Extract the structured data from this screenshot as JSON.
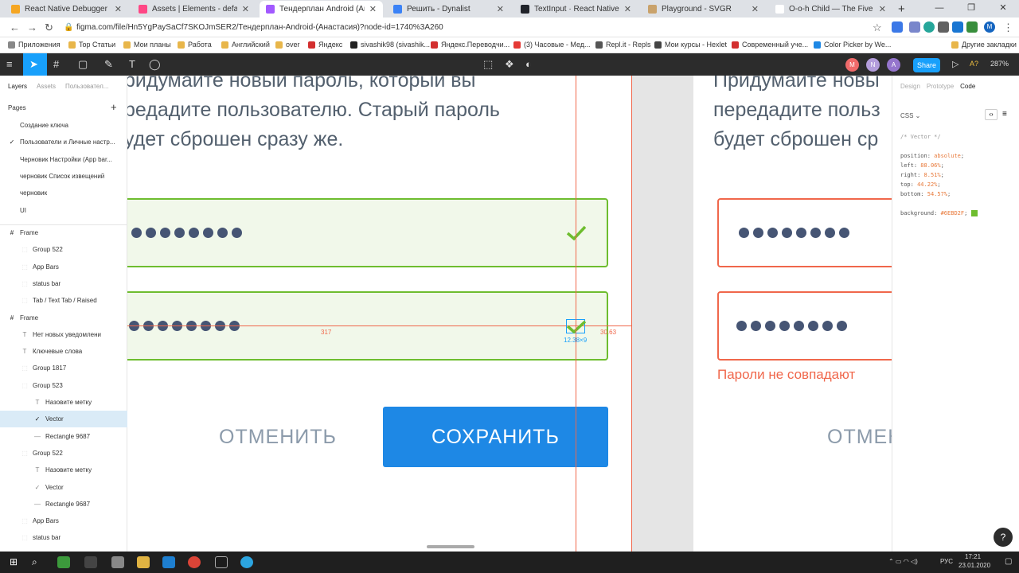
{
  "browser": {
    "tabs": [
      {
        "title": "React Native Debugger",
        "color": "#f5a623"
      },
      {
        "title": "Assets | Elements - default · Story",
        "color": "#ff4785"
      },
      {
        "title": "Тендерплан Android (Анастасия)",
        "color": "#a259ff"
      },
      {
        "title": "Решить - Dynalist",
        "color": "#3b82f6"
      },
      {
        "title": "TextInput · React Native",
        "color": "#20232a"
      },
      {
        "title": "Playground - SVGR",
        "color": "#c9a26b"
      },
      {
        "title": "O-o-h Child — The Five Stair",
        "color": "#ffffff"
      }
    ],
    "url": "figma.com/file/Hn5YgPaySaCf7SKOJmSER2/Тендерплан-Android-(Анастасия)?node-id=1740%3A260",
    "bookmarks": [
      "Приложения",
      "Top Статьи",
      "Мои планы",
      "Работа",
      "Английский",
      "over",
      "Яндекс",
      "sivashik98 (sivashik...",
      "Яндекс.Переводчи...",
      "(3) Часовые - Мед...",
      "Repl.it - Repls",
      "Мои курсы - Hexlet",
      "Современный уче...",
      "Color Picker by We...",
      "Другие закладки"
    ]
  },
  "figma": {
    "toolbar": {
      "share_label": "Share",
      "zoom": "287%",
      "avatars": [
        "M",
        "N",
        "A"
      ]
    },
    "left_panel": {
      "tabs": [
        "Layers",
        "Assets",
        "Пользовател..."
      ],
      "pages_label": "Pages",
      "pages": [
        {
          "name": "Создание ключа",
          "current": false
        },
        {
          "name": "Пользователи и Личные настр...",
          "current": true
        },
        {
          "name": "Черновик Настройки (App bar...",
          "current": false
        },
        {
          "name": "черновик Список извещений",
          "current": false
        },
        {
          "name": "черновик",
          "current": false
        },
        {
          "name": "UI",
          "current": false
        }
      ],
      "layers": [
        {
          "name": "Frame",
          "icon": "#",
          "indent": 0,
          "selected": false
        },
        {
          "name": "Group 522",
          "icon": "",
          "indent": 1,
          "selected": false
        },
        {
          "name": "App Bars",
          "icon": "",
          "indent": 1,
          "selected": false
        },
        {
          "name": "status bar",
          "icon": "",
          "indent": 1,
          "selected": false
        },
        {
          "name": "Tab / Text Tab / Raised",
          "icon": "",
          "indent": 1,
          "selected": false
        },
        {
          "name": "Frame",
          "icon": "#",
          "indent": 0,
          "selected": false
        },
        {
          "name": "Нет новых уведомлени",
          "icon": "T",
          "indent": 1,
          "selected": false
        },
        {
          "name": "Ключевые слова",
          "icon": "T",
          "indent": 1,
          "selected": false
        },
        {
          "name": "Group 1817",
          "icon": "",
          "indent": 1,
          "selected": false
        },
        {
          "name": "Group 523",
          "icon": "",
          "indent": 1,
          "selected": false
        },
        {
          "name": "Назовите метку",
          "icon": "T",
          "indent": 2,
          "selected": false
        },
        {
          "name": "Vector",
          "icon": "✓",
          "indent": 2,
          "selected": true
        },
        {
          "name": "Rectangle 9687",
          "icon": "—",
          "indent": 2,
          "selected": false
        },
        {
          "name": "Group 522",
          "icon": "",
          "indent": 1,
          "selected": false
        },
        {
          "name": "Назовите метку",
          "icon": "T",
          "indent": 2,
          "selected": false
        },
        {
          "name": "Vector",
          "icon": "✓",
          "indent": 2,
          "selected": false
        },
        {
          "name": "Rectangle 9687",
          "icon": "—",
          "indent": 2,
          "selected": false
        },
        {
          "name": "App Bars",
          "icon": "",
          "indent": 1,
          "selected": false
        },
        {
          "name": "status bar",
          "icon": "",
          "indent": 1,
          "selected": false
        }
      ]
    },
    "canvas": {
      "frame1": {
        "text_lines": [
          "ридумайте новый пароль, который вы",
          "редадите пользователю. Старый пароль",
          "удет сброшен сразу же."
        ],
        "cancel_label": "ОТМЕНИТЬ",
        "save_label": "СОХРАНИТЬ",
        "password_dots": 8,
        "measure_left": "317",
        "measure_right": "30.63",
        "selection_size": "12.38×9",
        "field_color": "#6EBD2F"
      },
      "frame2": {
        "text_lines": [
          "Придумайте новы",
          "передадите польз",
          "будет сброшен ср"
        ],
        "error_text": "Пароли не совпадают",
        "cancel_label": "ОТМЕН",
        "password_dots": 8,
        "field_color": "#F0674B"
      }
    },
    "right_panel": {
      "tabs": [
        "Design",
        "Prototype",
        "Code"
      ],
      "lang": "CSS",
      "code_comment": "/* Vector */",
      "code": [
        {
          "prop": "position",
          "val": "absolute"
        },
        {
          "prop": "left",
          "val": "88.06%"
        },
        {
          "prop": "right",
          "val": "8.51%"
        },
        {
          "prop": "top",
          "val": "44.22%"
        },
        {
          "prop": "bottom",
          "val": "54.57%"
        }
      ],
      "background_prop": "background",
      "background_val": "#6EBD2F"
    }
  },
  "taskbar": {
    "lang": "РУС",
    "time": "17:21",
    "date": "23.01.2020"
  }
}
